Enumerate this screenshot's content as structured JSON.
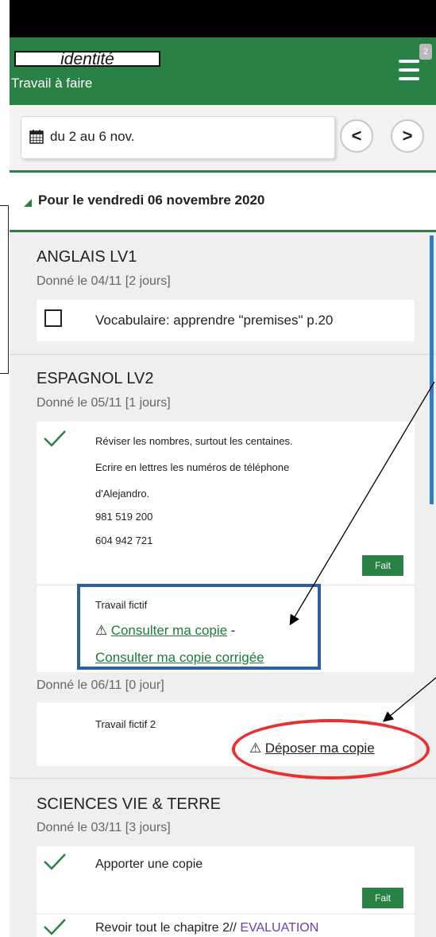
{
  "header": {
    "identity_label": "identité",
    "subtitle": "Travail à faire",
    "menu_badge": "2"
  },
  "datebar": {
    "range": "du 2 au 6 nov.",
    "prev": "<",
    "next": ">"
  },
  "section": {
    "title": "Pour le vendredi 06 novembre 2020"
  },
  "subjects": [
    {
      "name": "ANGLAIS LV1",
      "given": "Donné le 04/11 [2 jours]",
      "tasks": [
        {
          "text": "Vocabulaire: apprendre \"premises\" p.20",
          "done": false
        }
      ]
    },
    {
      "name": "ESPAGNOL LV2",
      "given": "Donné le 05/11 [1 jours]",
      "tasks": [
        {
          "lines": [
            "Réviser les nombres, surtout les centaines.",
            "Ecrire en lettres les numéros de téléphone",
            "d'Alejandro.",
            "981 519 200",
            "604 942 721"
          ],
          "done": true,
          "button": "Fait"
        },
        {
          "title": "Travail fictif",
          "link1": "Consulter ma copie",
          "separator": "-",
          "link2": "Consulter ma copie corrigée"
        }
      ],
      "given2": "Donné le 06/11 [0 jour]",
      "tasks2": [
        {
          "title": "Travail fictif 2",
          "link": "Déposer ma copie"
        }
      ]
    },
    {
      "name": "SCIENCES VIE & TERRE",
      "given": "Donné le 03/11 [3 jours]",
      "tasks": [
        {
          "text": "Apporter une copie",
          "done": true,
          "button": "Fait"
        },
        {
          "text_prefix": "Revoir tout le chapitre 2// ",
          "text_highlight": "EVALUATION",
          "done": true
        }
      ]
    }
  ],
  "colors": {
    "brand_green": "#2a8146",
    "link_green": "#1f7a3c",
    "annotation_blue": "#2e5f9e",
    "annotation_red": "#e8312f",
    "evaluation_purple": "#6a3fb1"
  }
}
